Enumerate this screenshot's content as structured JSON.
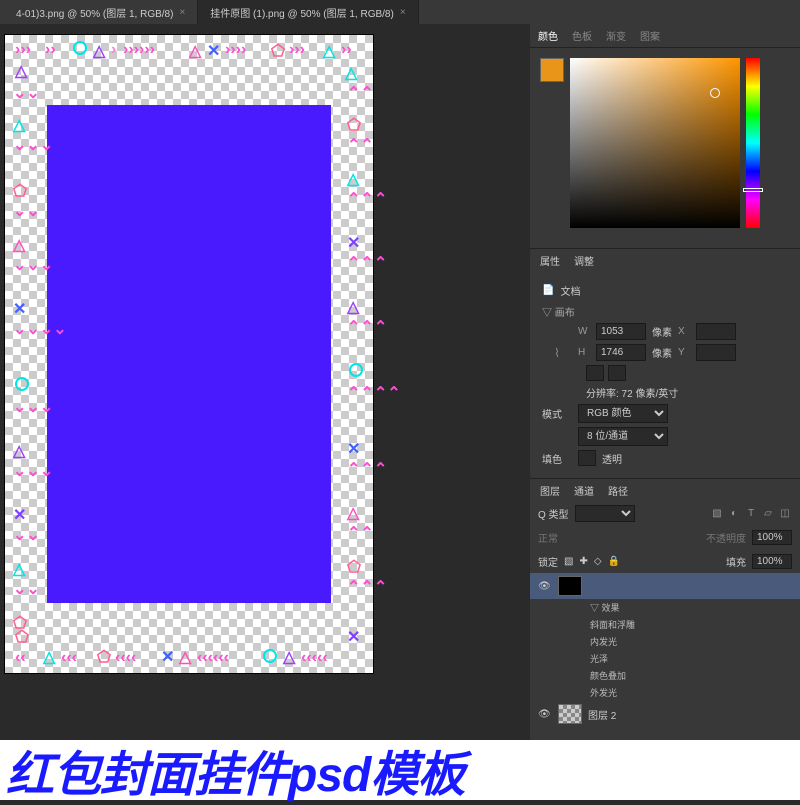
{
  "tabs": [
    {
      "label": "4-01)3.png @ 50% (图层 1, RGB/8)",
      "active": false
    },
    {
      "label": "挂件原图 (1).png @ 50% (图层 1, RGB/8)",
      "active": true
    }
  ],
  "color_panel": {
    "tabs": [
      "颜色",
      "色板",
      "渐变",
      "图案"
    ],
    "active_tab": "颜色",
    "swatch_color": "#e8951a"
  },
  "properties_panel": {
    "tabs": [
      "属性",
      "调整"
    ],
    "active_tab": "属性",
    "doc_label": "文档",
    "section_canvas": "画布",
    "width_label": "W",
    "width_value": "1053",
    "width_unit": "像素",
    "width_x": "X",
    "height_label": "H",
    "height_value": "1746",
    "height_unit": "像素",
    "height_y": "Y",
    "resolution_label": "分辨率: 72 像素/英寸",
    "mode_label": "模式",
    "mode_value": "RGB 颜色",
    "depth_value": "8 位/通道",
    "fill_label": "填色",
    "fill_value": "透明"
  },
  "layers_panel": {
    "tabs": [
      "图层",
      "通道",
      "路径"
    ],
    "active_tab": "图层",
    "filter_label": "Q 类型",
    "opacity_label": "不透明度",
    "opacity_value": "100%",
    "lock_label": "锁定",
    "fill_label": "填充",
    "fill_value": "100%",
    "effects_label": "效果",
    "fx_items": [
      "斜面和浮雕",
      "内发光",
      "光泽",
      "颜色叠加",
      "外发光"
    ],
    "layers": [
      {
        "name": "",
        "selected": true,
        "has_fx": true
      },
      {
        "name": "图层 2",
        "selected": false,
        "has_fx": false
      }
    ]
  },
  "caption": "红包封面挂件psd模板"
}
